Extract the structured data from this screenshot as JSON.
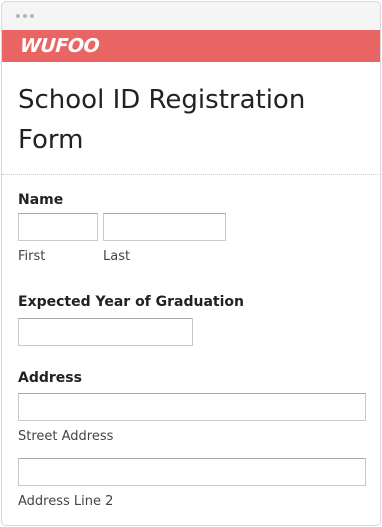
{
  "brand": {
    "logo_text": "WUFOO",
    "bar_color": "#e86563"
  },
  "form": {
    "title": "School ID Registration Form",
    "name_field": {
      "label": "Name",
      "first_sublabel": "First",
      "last_sublabel": "Last",
      "first_value": "",
      "last_value": ""
    },
    "grad_year_field": {
      "label": "Expected Year of Graduation",
      "value": ""
    },
    "address_field": {
      "label": "Address",
      "street_sublabel": "Street Address",
      "line2_sublabel": "Address Line 2",
      "street_value": "",
      "line2_value": ""
    }
  }
}
